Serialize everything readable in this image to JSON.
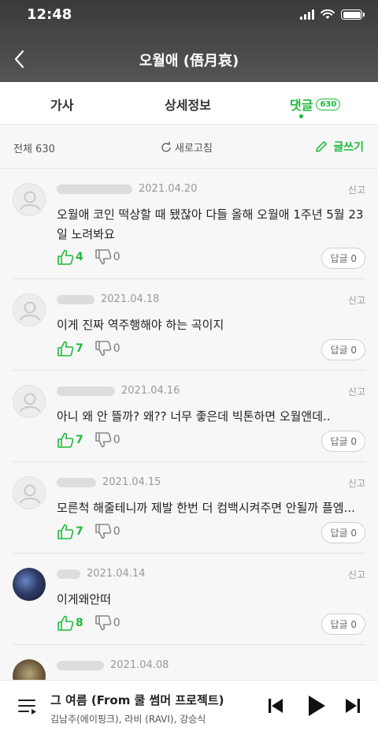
{
  "status": {
    "time": "12:48"
  },
  "nav": {
    "title": "오월애 (俉月哀)"
  },
  "tabs": [
    {
      "label": "가사"
    },
    {
      "label": "상세정보"
    },
    {
      "label": "댓글",
      "count": "630"
    }
  ],
  "toolbar": {
    "total": "전체 630",
    "refresh": "새로고침",
    "write": "글쓰기"
  },
  "comments": [
    {
      "date": "2021.04.20",
      "text": "오월애 코인 떡상할 때 됐잖아 다들 올해 오월애 1주년 5월 23일 노려봐요",
      "likes": "4",
      "dislikes": "0",
      "reply": "답글 0",
      "report": "신고"
    },
    {
      "date": "2021.04.18",
      "text": "이게 진짜 역주행해야 하는 곡이지",
      "likes": "7",
      "dislikes": "0",
      "reply": "답글 0",
      "report": "신고"
    },
    {
      "date": "2021.04.16",
      "text": "아니 왜 안 뜰까? 왜?? 너무 좋은데 빅톤하면 오월앤데..",
      "likes": "7",
      "dislikes": "0",
      "reply": "답글 0",
      "report": "신고"
    },
    {
      "date": "2021.04.15",
      "text": "모른척 해줄테니까 제발 한번 더 컴백시켜주면 안될까 플엠...",
      "likes": "7",
      "dislikes": "0",
      "reply": "답글 0",
      "report": "신고"
    },
    {
      "date": "2021.04.14",
      "text": "이게왜안떠",
      "likes": "8",
      "dislikes": "0",
      "reply": "답글 0",
      "report": "신고"
    },
    {
      "date": "2021.04.08",
      "text": "",
      "likes": "",
      "dislikes": "",
      "reply": "",
      "report": ""
    }
  ],
  "player": {
    "song": "그 여름 (From 쿨 썸머 프로젝트)",
    "artist": "김남주(에이핑크), 라비 (RAVI), 강승식"
  },
  "colors": {
    "accent": "#1fbb3c"
  }
}
